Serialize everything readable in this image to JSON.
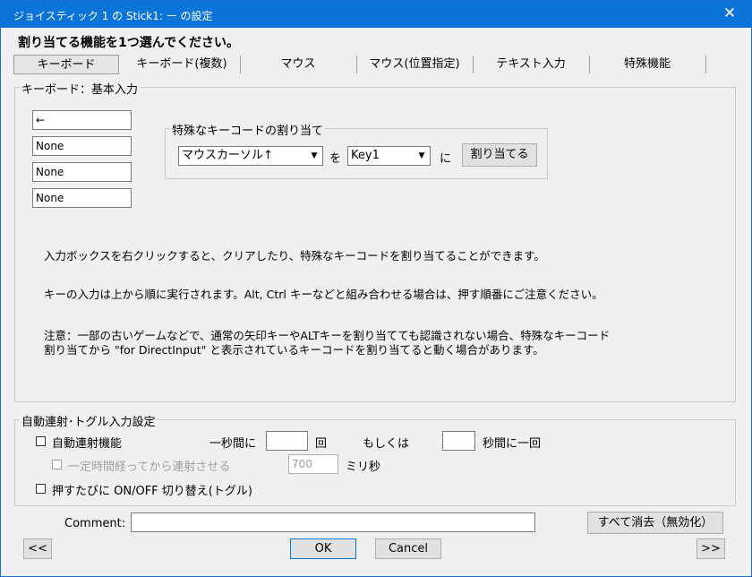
{
  "window": {
    "title": "ジョイスティック 1 の Stick1: ー の設定",
    "close": "✕"
  },
  "prompt": "割り当てる機能を1つ選んでください。",
  "tabs": [
    "キーボード",
    "キーボード(複数)",
    "マウス",
    "マウス(位置指定)",
    "テキスト入力",
    "特殊機能"
  ],
  "keyboard_group": {
    "label": "キーボード：基本入力",
    "inputs": [
      "←",
      "None",
      "None",
      "None"
    ],
    "special": {
      "label": "特殊なキーコードの割り当て",
      "source_value": "マウスカーソル↑",
      "wo": "を",
      "target_value": "Key1",
      "ni": "に",
      "assign_button": "割り当てる"
    },
    "info": [
      "入力ボックスを右クリックすると、クリアしたり、特殊なキーコードを割り当てることができます。",
      "キーの入力は上から順に実行されます。Alt, Ctrl キーなどと組み合わせる場合は、押す順番にご注意ください。",
      "注意：一部の古いゲームなどで、通常の矢印キーやALTキーを割り当てても認識されない場合、特殊なキーコード",
      "割り当てから \"for DirectInput\" と表示されているキーコードを割り当てると動く場合があります。"
    ]
  },
  "autofire_group": {
    "label": "自動連射･トグル入力設定",
    "autofire_label": "自動連射機能",
    "per_second_label": "一秒間に",
    "per_second_value": "",
    "times_label": "回",
    "or_label": "もしくは",
    "seconds_value": "",
    "seconds_suffix": "秒間に一回",
    "delay_label": "一定時間経ってから連射させる",
    "delay_value": "700",
    "ms_label": "ミリ秒",
    "toggle_label": "押すたびに ON/OFF 切り替え(トグル)"
  },
  "comment": {
    "label": "Comment:",
    "value": ""
  },
  "buttons": {
    "clear_all": "すべて消去（無効化）",
    "prev": "<<",
    "ok": "OK",
    "cancel": "Cancel",
    "next": ">>"
  }
}
